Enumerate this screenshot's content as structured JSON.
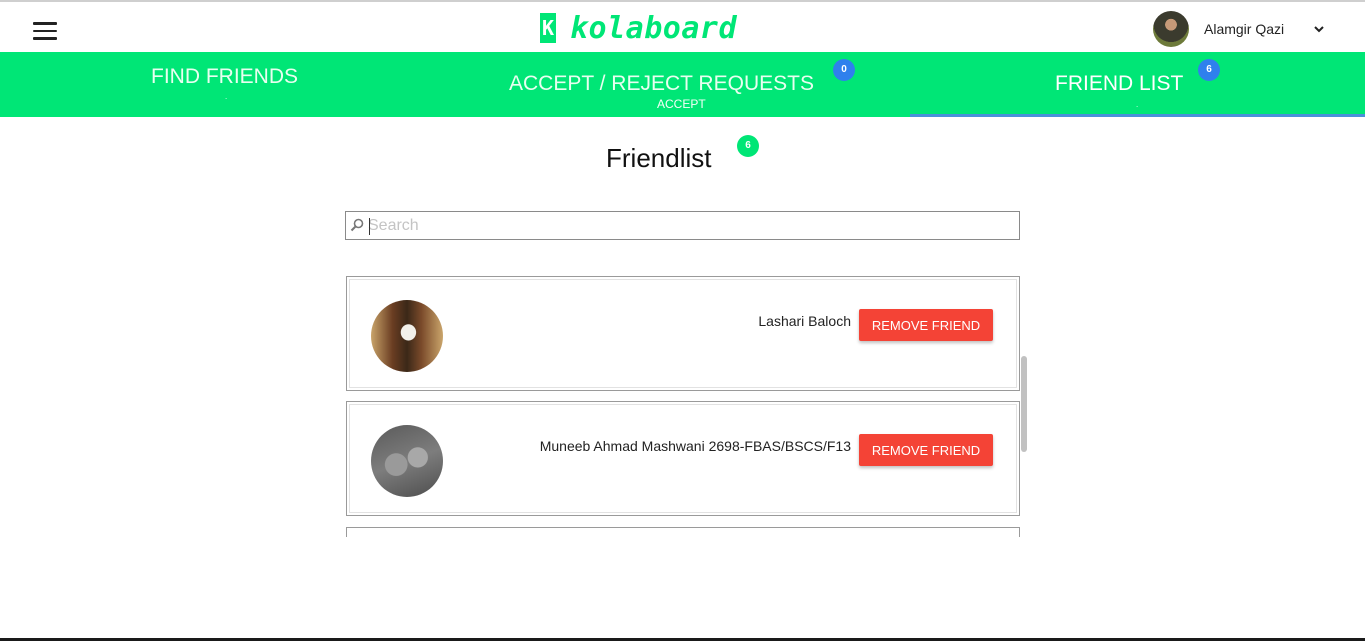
{
  "header": {
    "logo_mark": "K",
    "logo_text": "kolaboard",
    "user_name": "Alamgir Qazi",
    "icons": {
      "menu": "hamburger-menu-icon",
      "dropdown": "chevron-down-icon",
      "search": "magnifier-icon"
    }
  },
  "tabs": [
    {
      "label": "FIND FRIENDS",
      "sub": "."
    },
    {
      "label": "ACCEPT / REJECT REQUESTS",
      "sub": "ACCEPT",
      "badge": "0"
    },
    {
      "label": "FRIEND LIST",
      "sub": ".",
      "badge": "6",
      "active": true
    }
  ],
  "colors": {
    "brand_green": "#00e676",
    "badge_blue": "#2f80ed",
    "remove_red": "#f44336",
    "active_underline": "#4a90d9"
  },
  "main": {
    "title": "Friendlist",
    "count_badge": "6",
    "search_placeholder": "Search"
  },
  "friends": [
    {
      "name": "Lashari Baloch",
      "action": "REMOVE FRIEND"
    },
    {
      "name": "Muneeb Ahmad Mashwani 2698-FBAS/BSCS/F13",
      "action": "REMOVE FRIEND"
    }
  ]
}
